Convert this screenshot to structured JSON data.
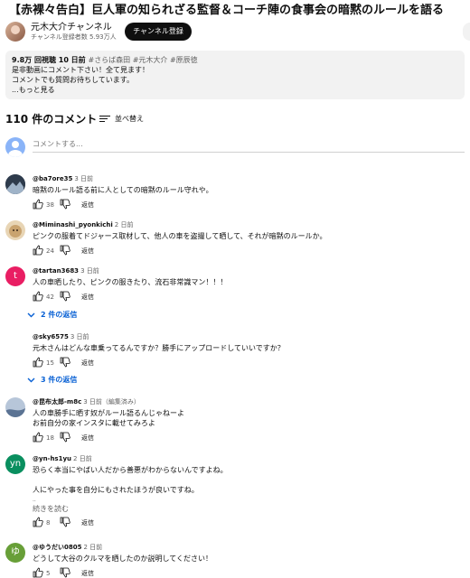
{
  "video": {
    "title": "【赤裸々告白】巨人軍の知られざる監督＆コーチ陣の食事会の暗黙のルールを語る",
    "channel_name": "元木大介チャンネル",
    "subscribers": "チャンネル登録者数 5.93万人",
    "subscribe_label": "チャンネル登録"
  },
  "description": {
    "views": "9.8万 回視聴",
    "age": "10 日前",
    "tags": "#さらば森田 #元木大介 #原辰徳",
    "line1": "是非動画にコメント下さい！全て見ます！",
    "line2": "コメントでも質問お待ちしています。",
    "more": "...もっと見る"
  },
  "comments_header": {
    "count": "110 件のコメント",
    "sort_label": "並べ替え"
  },
  "add_comment": {
    "placeholder": "コメントする..."
  },
  "comments": [
    {
      "author": "@ba7ore35",
      "time": "3 日前",
      "text": "暗黙のルール語る前に人としての暗黙のルール守れや。",
      "likes": "38",
      "reply": "返信",
      "avatar_color": "#3a4a5c"
    },
    {
      "author": "@Miminashi_pyonkichi",
      "time": "2 日前",
      "text": "ピンクの服着てドジャース取材して、他人の車を盗撮して晒して、それが暗黙のルールか。",
      "likes": "24",
      "reply": "返信",
      "avatar_color": "#c9a36f"
    },
    {
      "author": "@tartan3683",
      "time": "3 日前",
      "text": "人の車晒したり、ピンクの服きたり、流石非常識マン！！！",
      "likes": "42",
      "reply": "返信",
      "avatar_letter": "t",
      "avatar_color": "#e91e63",
      "replies": "2 件の返信"
    },
    {
      "author": "@sky6575",
      "time": "3 日前",
      "text": "元木さんはどんな車乗ってるんですか？勝手にアップロードしていいですか？",
      "likes": "15",
      "reply": "返信",
      "avatar_color": "#ffffff",
      "replies": "3 件の返信"
    },
    {
      "author": "@昆布太郎-m8c",
      "time": "3 日前（編集済み）",
      "text": "人の車勝手に晒す奴がルール語るんじゃねーよ",
      "text2": "お前自分の家インスタに載せてみろよ",
      "likes": "18",
      "reply": "返信",
      "avatar_color": "#7a8ea8"
    },
    {
      "author": "@yn-hs1yu",
      "time": "2 日前",
      "text": "恐らく本当にやばい人だから善悪がわからないんですよね。",
      "text2": "人にやった事を自分にもされたほうが良いですね。",
      "ellipsis": "..",
      "more": "続きを読む",
      "likes": "8",
      "reply": "返信",
      "avatar_letter": "yn",
      "avatar_color": "#0a8f5f"
    },
    {
      "author": "@ゆうだい0805",
      "time": "2 日前",
      "text": "どうして大谷のクルマを晒したのか説明してください！",
      "likes": "5",
      "reply": "返信",
      "avatar_letter": "ゆ",
      "avatar_color": "#689f38"
    }
  ]
}
